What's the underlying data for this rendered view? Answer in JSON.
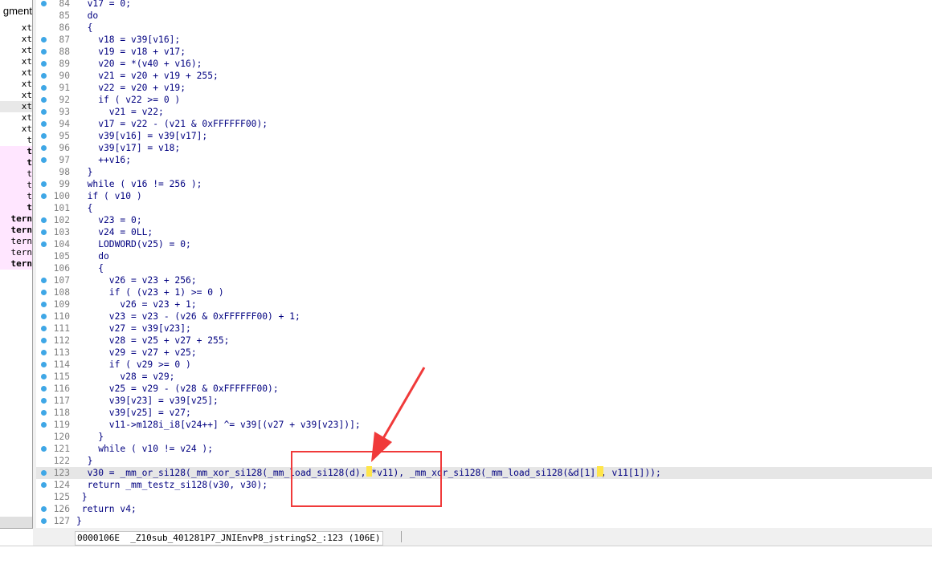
{
  "segment_panel": {
    "header": "gment",
    "rows": [
      {
        "text": "xt",
        "style": ""
      },
      {
        "text": "xt",
        "style": ""
      },
      {
        "text": "xt",
        "style": ""
      },
      {
        "text": "xt",
        "style": ""
      },
      {
        "text": "xt",
        "style": ""
      },
      {
        "text": "xt",
        "style": ""
      },
      {
        "text": "xt",
        "style": ""
      },
      {
        "text": "xt",
        "style": "sel"
      },
      {
        "text": "xt",
        "style": ""
      },
      {
        "text": "xt",
        "style": ""
      },
      {
        "text": "t",
        "style": ""
      },
      {
        "text": "t",
        "style": "pink bold"
      },
      {
        "text": "t",
        "style": "pink bold"
      },
      {
        "text": "t",
        "style": "pink"
      },
      {
        "text": "t",
        "style": "pink"
      },
      {
        "text": "t",
        "style": "pink"
      },
      {
        "text": "t",
        "style": "pink bold"
      },
      {
        "text": "tern",
        "style": "pink bold"
      },
      {
        "text": "tern",
        "style": "pink bold"
      },
      {
        "text": "tern",
        "style": "pink"
      },
      {
        "text": "tern",
        "style": "pink"
      },
      {
        "text": "tern",
        "style": "pink bold"
      }
    ]
  },
  "code_lines": [
    {
      "num": "84",
      "code": "  v17 = 0;",
      "dot": true
    },
    {
      "num": "85",
      "code": "  do",
      "dot": false
    },
    {
      "num": "86",
      "code": "  {",
      "dot": false
    },
    {
      "num": "87",
      "code": "    v18 = v39[v16];",
      "dot": true
    },
    {
      "num": "88",
      "code": "    v19 = v18 + v17;",
      "dot": true
    },
    {
      "num": "89",
      "code": "    v20 = *(v40 + v16);",
      "dot": true
    },
    {
      "num": "90",
      "code": "    v21 = v20 + v19 + 255;",
      "dot": true
    },
    {
      "num": "91",
      "code": "    v22 = v20 + v19;",
      "dot": true
    },
    {
      "num": "92",
      "code": "    if ( v22 >= 0 )",
      "dot": true
    },
    {
      "num": "93",
      "code": "      v21 = v22;",
      "dot": true
    },
    {
      "num": "94",
      "code": "    v17 = v22 - (v21 & 0xFFFFFF00);",
      "dot": true
    },
    {
      "num": "95",
      "code": "    v39[v16] = v39[v17];",
      "dot": true
    },
    {
      "num": "96",
      "code": "    v39[v17] = v18;",
      "dot": true
    },
    {
      "num": "97",
      "code": "    ++v16;",
      "dot": true
    },
    {
      "num": "98",
      "code": "  }",
      "dot": false
    },
    {
      "num": "99",
      "code": "  while ( v16 != 256 );",
      "dot": true
    },
    {
      "num": "100",
      "code": "  if ( v10 )",
      "dot": true
    },
    {
      "num": "101",
      "code": "  {",
      "dot": false
    },
    {
      "num": "102",
      "code": "    v23 = 0;",
      "dot": true
    },
    {
      "num": "103",
      "code": "    v24 = 0LL;",
      "dot": true
    },
    {
      "num": "104",
      "code": "    LODWORD(v25) = 0;",
      "dot": true
    },
    {
      "num": "105",
      "code": "    do",
      "dot": false
    },
    {
      "num": "106",
      "code": "    {",
      "dot": false
    },
    {
      "num": "107",
      "code": "      v26 = v23 + 256;",
      "dot": true
    },
    {
      "num": "108",
      "code": "      if ( (v23 + 1) >= 0 )",
      "dot": true
    },
    {
      "num": "109",
      "code": "        v26 = v23 + 1;",
      "dot": true
    },
    {
      "num": "110",
      "code": "      v23 = v23 - (v26 & 0xFFFFFF00) + 1;",
      "dot": true
    },
    {
      "num": "111",
      "code": "      v27 = v39[v23];",
      "dot": true
    },
    {
      "num": "112",
      "code": "      v28 = v25 + v27 + 255;",
      "dot": true
    },
    {
      "num": "113",
      "code": "      v29 = v27 + v25;",
      "dot": true
    },
    {
      "num": "114",
      "code": "      if ( v29 >= 0 )",
      "dot": true
    },
    {
      "num": "115",
      "code": "        v28 = v29;",
      "dot": true
    },
    {
      "num": "116",
      "code": "      v25 = v29 - (v28 & 0xFFFFFF00);",
      "dot": true
    },
    {
      "num": "117",
      "code": "      v39[v23] = v39[v25];",
      "dot": true
    },
    {
      "num": "118",
      "code": "      v39[v25] = v27;",
      "dot": true
    },
    {
      "num": "119",
      "code": "      v11->m128i_i8[v24++] ^= v39[(v27 + v39[v23])];",
      "dot": true
    },
    {
      "num": "120",
      "code": "    }",
      "dot": false
    },
    {
      "num": "121",
      "code": "    while ( v10 != v24 );",
      "dot": true
    },
    {
      "num": "122",
      "code": "  }",
      "dot": false
    },
    {
      "num": "123",
      "code": "  v30 = _mm_or_si128(_mm_xor_si128(_mm_load_si128(d), *v11), _mm_xor_si128(_mm_load_si128(&d[1]), v11[1]));",
      "dot": true,
      "highlight": true
    },
    {
      "num": "124",
      "code": "  return _mm_testz_si128(v30, v30);",
      "dot": true
    },
    {
      "num": "125",
      "code": " }",
      "dot": false
    },
    {
      "num": "126",
      "code": " return v4;",
      "dot": true
    },
    {
      "num": "127",
      "code": "}",
      "dot": true
    }
  ],
  "status_bar": {
    "location": "0000106E  _Z10sub_401281P7_JNIEnvP8_jstringS2_:123 (106E)"
  },
  "colors": {
    "code_text": "#000080",
    "line_number": "#808080",
    "breakpoint_dot": "#3fa7e6",
    "annotation_red": "#f03a3a",
    "highlight_yellow": "#ffe54a"
  }
}
